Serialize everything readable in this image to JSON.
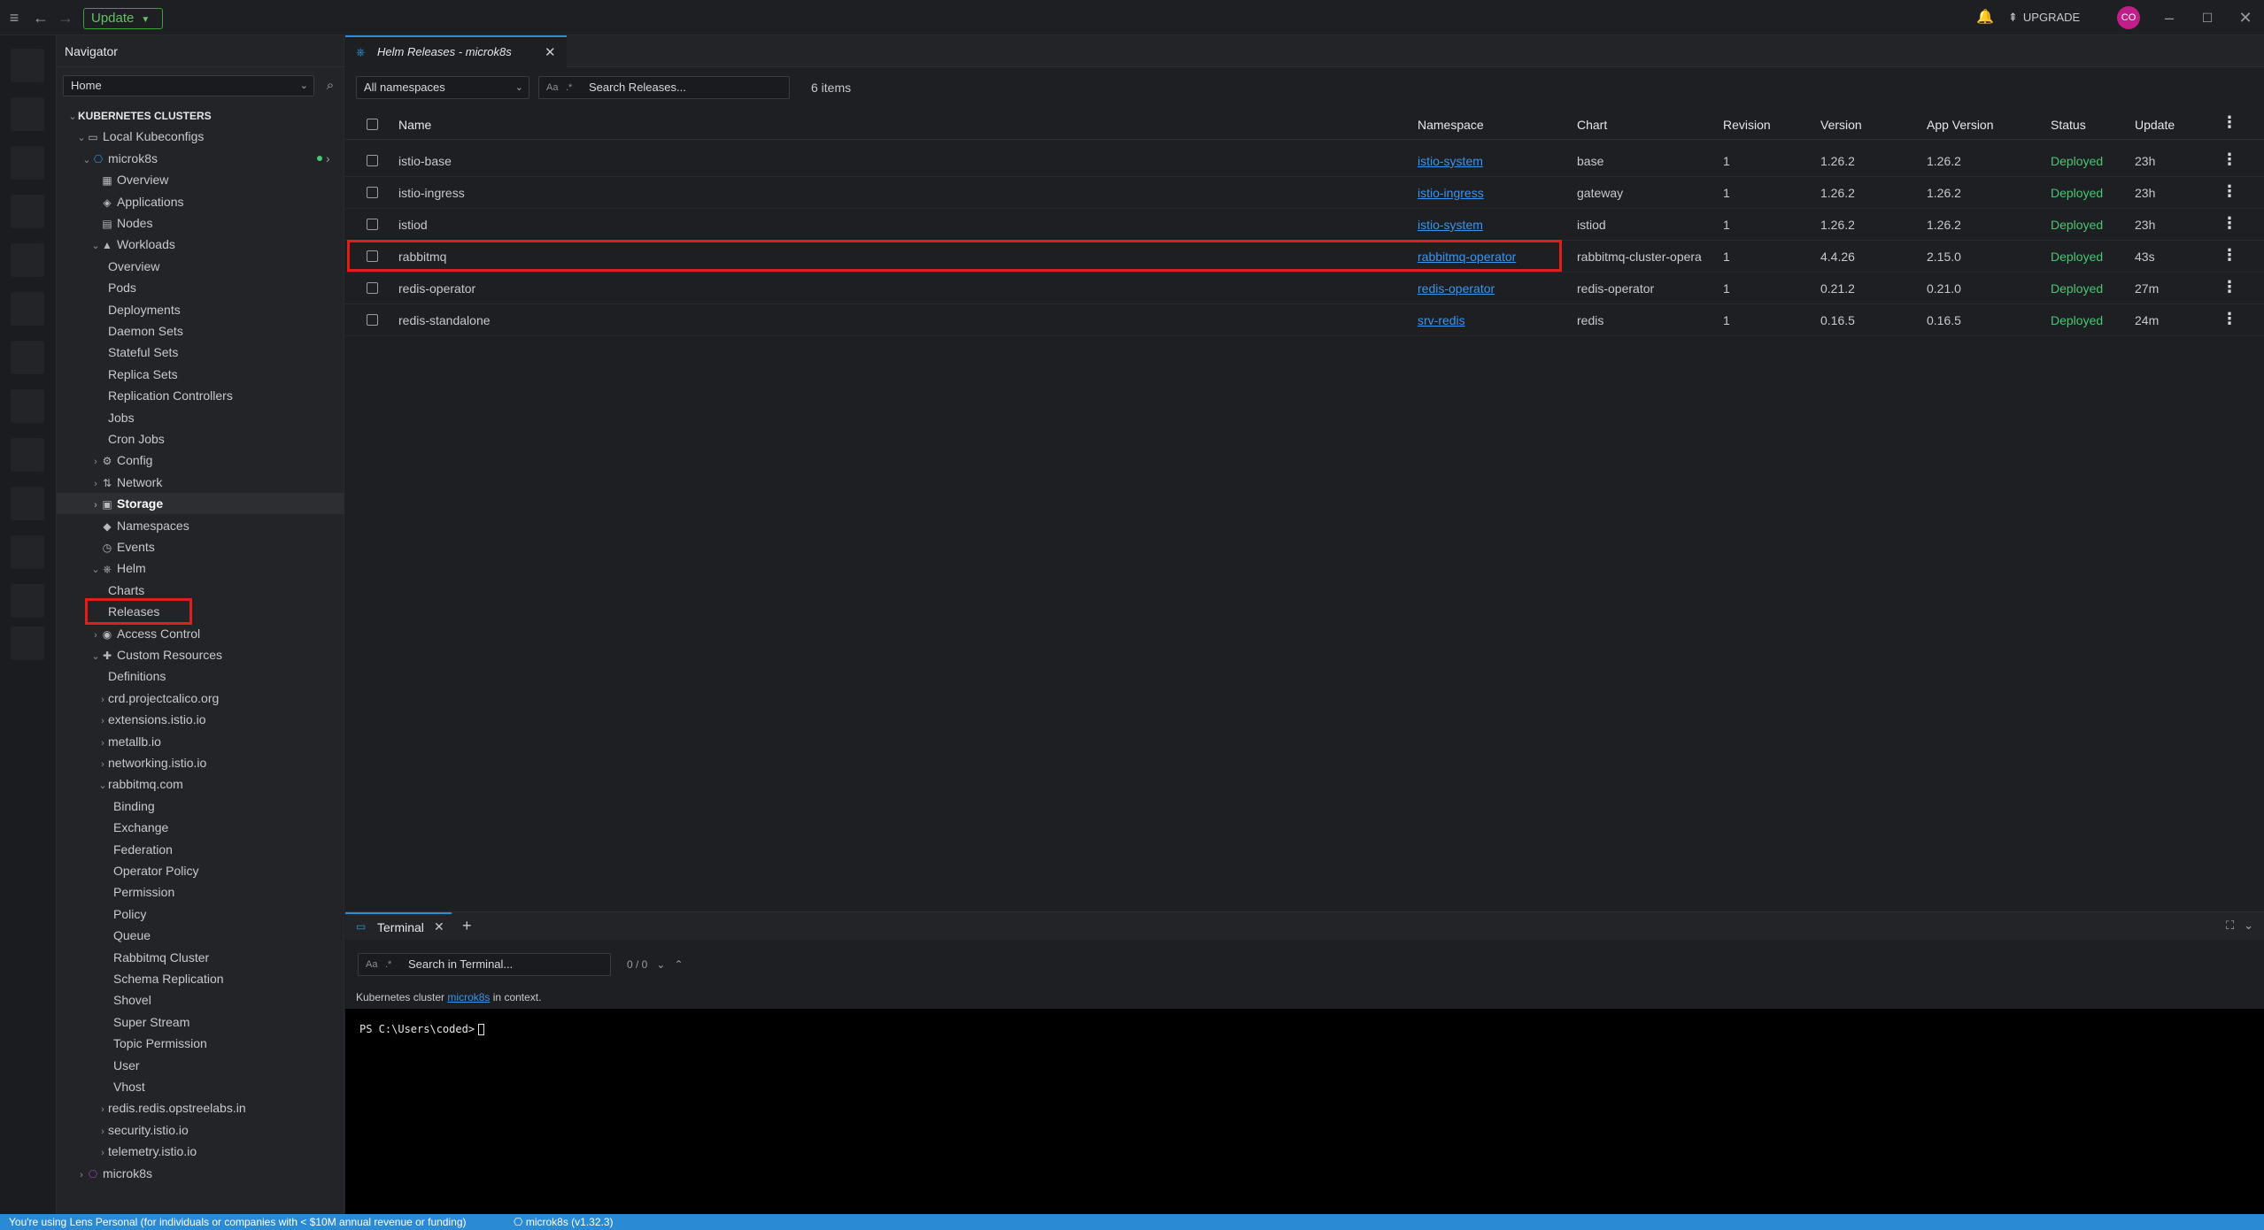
{
  "topbar": {
    "update_label": "Update",
    "upgrade_label": "UPGRADE",
    "avatar_initials": "CO"
  },
  "navigator": {
    "title": "Navigator",
    "home_select": "Home",
    "tree": [
      {
        "label": "KUBERNETES CLUSTERS",
        "indent": 0,
        "chev": "v",
        "icon": "",
        "bold": true
      },
      {
        "label": "Local Kubeconfigs",
        "indent": 1,
        "chev": "v",
        "icon": "laptop-icon"
      },
      {
        "label": "microk8s",
        "indent": 2,
        "chev": "v",
        "icon": "cluster-icon",
        "status": "connected"
      },
      {
        "label": "Overview",
        "indent": 3,
        "chev": "",
        "icon": "grid-icon"
      },
      {
        "label": "Applications",
        "indent": 3,
        "chev": "",
        "icon": "apps-icon"
      },
      {
        "label": "Nodes",
        "indent": 3,
        "chev": "",
        "icon": "nodes-icon"
      },
      {
        "label": "Workloads",
        "indent": 3,
        "chev": "v",
        "icon": "workloads-icon"
      },
      {
        "label": "Overview",
        "indent": 4,
        "chev": "",
        "icon": ""
      },
      {
        "label": "Pods",
        "indent": 4,
        "chev": "",
        "icon": ""
      },
      {
        "label": "Deployments",
        "indent": 4,
        "chev": "",
        "icon": ""
      },
      {
        "label": "Daemon Sets",
        "indent": 4,
        "chev": "",
        "icon": ""
      },
      {
        "label": "Stateful Sets",
        "indent": 4,
        "chev": "",
        "icon": ""
      },
      {
        "label": "Replica Sets",
        "indent": 4,
        "chev": "",
        "icon": ""
      },
      {
        "label": "Replication Controllers",
        "indent": 4,
        "chev": "",
        "icon": ""
      },
      {
        "label": "Jobs",
        "indent": 4,
        "chev": "",
        "icon": ""
      },
      {
        "label": "Cron Jobs",
        "indent": 4,
        "chev": "",
        "icon": ""
      },
      {
        "label": "Config",
        "indent": 3,
        "chev": ">",
        "icon": "config-icon"
      },
      {
        "label": "Network",
        "indent": 3,
        "chev": ">",
        "icon": "network-icon"
      },
      {
        "label": "Storage",
        "indent": 3,
        "chev": ">",
        "icon": "storage-icon",
        "selected": true
      },
      {
        "label": "Namespaces",
        "indent": 3,
        "chev": "",
        "icon": "namespaces-icon"
      },
      {
        "label": "Events",
        "indent": 3,
        "chev": "",
        "icon": "events-icon"
      },
      {
        "label": "Helm",
        "indent": 3,
        "chev": "v",
        "icon": "helm-icon"
      },
      {
        "label": "Charts",
        "indent": 4,
        "chev": "",
        "icon": ""
      },
      {
        "label": "Releases",
        "indent": 4,
        "chev": "",
        "icon": "",
        "highlight": true
      },
      {
        "label": "Access Control",
        "indent": 3,
        "chev": ">",
        "icon": "access-icon"
      },
      {
        "label": "Custom Resources",
        "indent": 3,
        "chev": "v",
        "icon": "puzzle-icon"
      },
      {
        "label": "Definitions",
        "indent": 4,
        "chev": "",
        "icon": ""
      },
      {
        "label": "crd.projectcalico.org",
        "indent": 4,
        "chev": ">",
        "icon": ""
      },
      {
        "label": "extensions.istio.io",
        "indent": 4,
        "chev": ">",
        "icon": ""
      },
      {
        "label": "metallb.io",
        "indent": 4,
        "chev": ">",
        "icon": ""
      },
      {
        "label": "networking.istio.io",
        "indent": 4,
        "chev": ">",
        "icon": ""
      },
      {
        "label": "rabbitmq.com",
        "indent": 4,
        "chev": "v",
        "icon": ""
      },
      {
        "label": "Binding",
        "indent": 5,
        "chev": "",
        "icon": ""
      },
      {
        "label": "Exchange",
        "indent": 5,
        "chev": "",
        "icon": ""
      },
      {
        "label": "Federation",
        "indent": 5,
        "chev": "",
        "icon": ""
      },
      {
        "label": "Operator Policy",
        "indent": 5,
        "chev": "",
        "icon": ""
      },
      {
        "label": "Permission",
        "indent": 5,
        "chev": "",
        "icon": ""
      },
      {
        "label": "Policy",
        "indent": 5,
        "chev": "",
        "icon": ""
      },
      {
        "label": "Queue",
        "indent": 5,
        "chev": "",
        "icon": ""
      },
      {
        "label": "Rabbitmq Cluster",
        "indent": 5,
        "chev": "",
        "icon": ""
      },
      {
        "label": "Schema Replication",
        "indent": 5,
        "chev": "",
        "icon": ""
      },
      {
        "label": "Shovel",
        "indent": 5,
        "chev": "",
        "icon": ""
      },
      {
        "label": "Super Stream",
        "indent": 5,
        "chev": "",
        "icon": ""
      },
      {
        "label": "Topic Permission",
        "indent": 5,
        "chev": "",
        "icon": ""
      },
      {
        "label": "User",
        "indent": 5,
        "chev": "",
        "icon": ""
      },
      {
        "label": "Vhost",
        "indent": 5,
        "chev": "",
        "icon": ""
      },
      {
        "label": "redis.redis.opstreelabs.in",
        "indent": 4,
        "chev": ">",
        "icon": ""
      },
      {
        "label": "security.istio.io",
        "indent": 4,
        "chev": ">",
        "icon": ""
      },
      {
        "label": "telemetry.istio.io",
        "indent": 4,
        "chev": ">",
        "icon": ""
      },
      {
        "label": "microk8s",
        "indent": 1,
        "chev": ">",
        "icon": "cluster-icon"
      }
    ],
    "pager": "1"
  },
  "tab": {
    "title": "Helm Releases - microk8s"
  },
  "toolbar": {
    "namespace_select": "All namespaces",
    "search_placeholder": "Search Releases...",
    "count": "6 items"
  },
  "table": {
    "headers": {
      "name": "Name",
      "namespace": "Namespace",
      "chart": "Chart",
      "revision": "Revision",
      "version": "Version",
      "app_version": "App Version",
      "status": "Status",
      "updated": "Update"
    },
    "rows": [
      {
        "name": "istio-base",
        "namespace": "istio-system",
        "chart": "base",
        "revision": "1",
        "version": "1.26.2",
        "app_version": "1.26.2",
        "status": "Deployed",
        "updated": "23h"
      },
      {
        "name": "istio-ingress",
        "namespace": "istio-ingress",
        "chart": "gateway",
        "revision": "1",
        "version": "1.26.2",
        "app_version": "1.26.2",
        "status": "Deployed",
        "updated": "23h"
      },
      {
        "name": "istiod",
        "namespace": "istio-system",
        "chart": "istiod",
        "revision": "1",
        "version": "1.26.2",
        "app_version": "1.26.2",
        "status": "Deployed",
        "updated": "23h"
      },
      {
        "name": "rabbitmq",
        "namespace": "rabbitmq-operator",
        "chart": "rabbitmq-cluster-opera",
        "revision": "1",
        "version": "4.4.26",
        "app_version": "2.15.0",
        "status": "Deployed",
        "updated": "43s",
        "highlight": true
      },
      {
        "name": "redis-operator",
        "namespace": "redis-operator",
        "chart": "redis-operator",
        "revision": "1",
        "version": "0.21.2",
        "app_version": "0.21.0",
        "status": "Deployed",
        "updated": "27m"
      },
      {
        "name": "redis-standalone",
        "namespace": "srv-redis",
        "chart": "redis",
        "revision": "1",
        "version": "0.16.5",
        "app_version": "0.16.5",
        "status": "Deployed",
        "updated": "24m"
      }
    ]
  },
  "terminal": {
    "tab_label": "Terminal",
    "search_placeholder": "Search in Terminal...",
    "match_count": "0 / 0",
    "context_prefix": "Kubernetes cluster",
    "context_cluster": "microk8s",
    "context_suffix": "in context.",
    "prompt": "PS C:\\Users\\coded>"
  },
  "statusbar": {
    "license_text": "You're using Lens Personal (for individuals or companies with < $10M annual revenue or funding)",
    "cluster": "microk8s (v1.32.3)"
  },
  "colors": {
    "accent": "#2c8fd6",
    "deployed": "#48c774",
    "highlight": "#e01e1e",
    "link": "#3a95ee"
  }
}
